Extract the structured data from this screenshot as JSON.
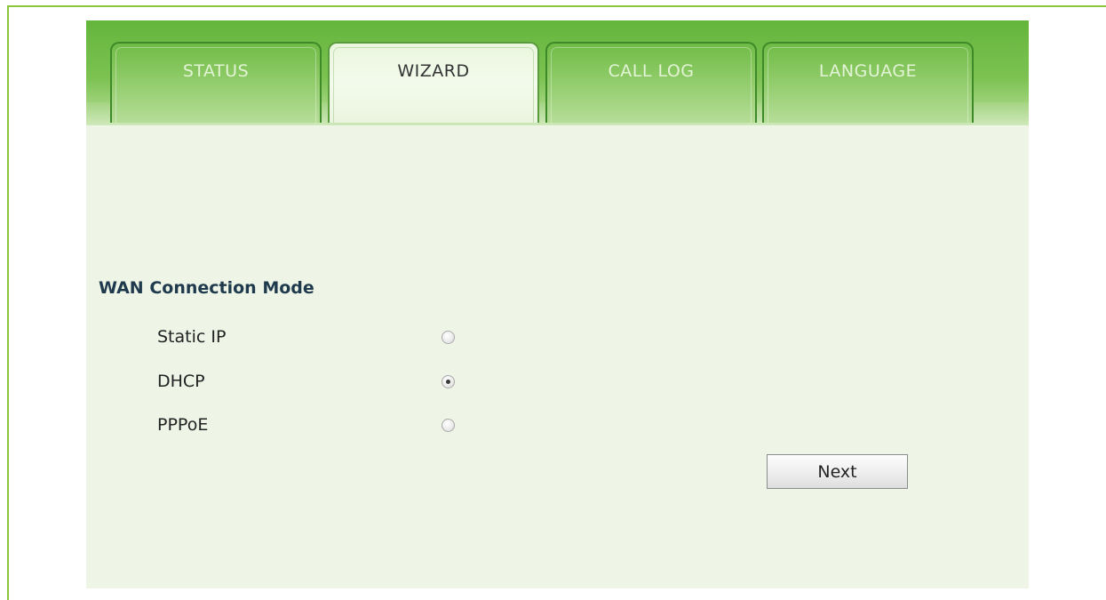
{
  "tabs": [
    {
      "label": "STATUS",
      "active": false
    },
    {
      "label": "WIZARD",
      "active": true
    },
    {
      "label": "CALL LOG",
      "active": false
    },
    {
      "label": "LANGUAGE",
      "active": false
    }
  ],
  "wizard": {
    "section_title": "WAN Connection Mode",
    "options": [
      {
        "label": "Static IP",
        "selected": false
      },
      {
        "label": "DHCP",
        "selected": true
      },
      {
        "label": "PPPoE",
        "selected": false
      }
    ],
    "next_label": "Next"
  },
  "colors": {
    "tab_bar_green": "#7cc252",
    "frame_green": "#8cc63f",
    "panel_bg": "#eef4e6",
    "title_text": "#1f3a4d"
  }
}
